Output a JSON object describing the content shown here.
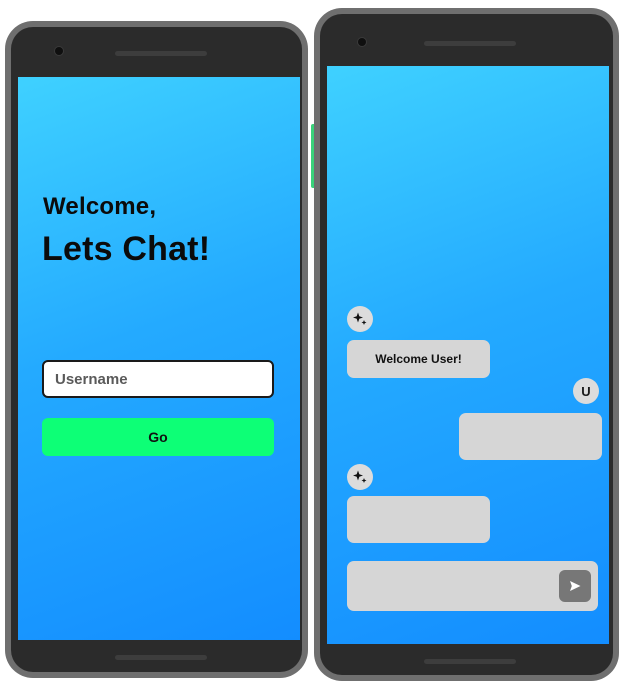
{
  "login": {
    "welcome_line": "Welcome,",
    "headline": "Lets Chat!",
    "username_placeholder": "Username",
    "username_value": "",
    "go_label": "Go"
  },
  "chat": {
    "messages": [
      {
        "sender": "bot",
        "avatar_icon": "sparkle-icon",
        "text": "Welcome User!"
      },
      {
        "sender": "user",
        "avatar_label": "U",
        "text": ""
      },
      {
        "sender": "bot",
        "avatar_icon": "sparkle-icon",
        "text": ""
      }
    ],
    "input_value": "",
    "send_icon": "send-icon"
  },
  "colors": {
    "screen_gradient_top": "#3fd1ff",
    "screen_gradient_bottom": "#138dff",
    "go_button": "#0dff76",
    "bubble": "#d6d6d6",
    "phone_frame": "#6f6f6f",
    "phone_bezel": "#2b2b2b"
  }
}
